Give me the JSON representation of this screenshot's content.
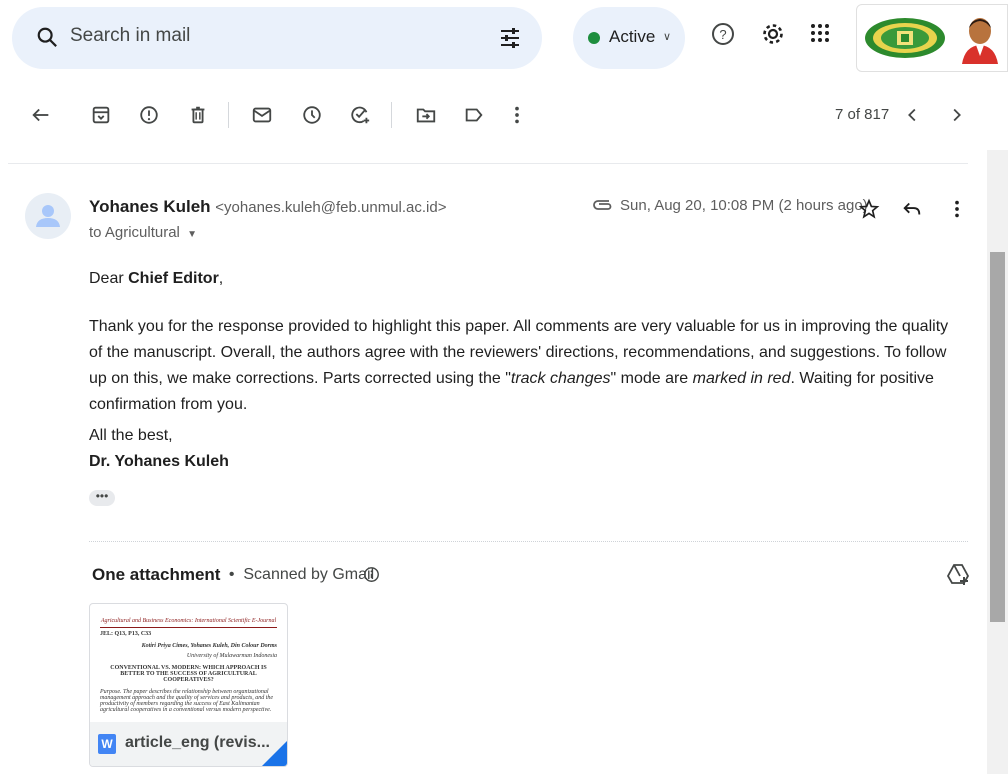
{
  "search": {
    "placeholder": "Search in mail"
  },
  "status": {
    "label": "Active"
  },
  "toolbar": {
    "pager": "7 of 817"
  },
  "message": {
    "sender_name": "Yohanes Kuleh",
    "sender_email": "<yohanes.kuleh@feb.unmul.ac.id>",
    "to_line": "to Agricultural",
    "date": "Sun, Aug 20, 10:08 PM (2 hours ago)",
    "greeting_prefix": "Dear ",
    "greeting_name": "Chief Editor",
    "greeting_suffix": ",",
    "para_1": "Thank you for the response provided to highlight this paper. All comments are very valuable for us in improving the quality of the manuscript. Overall, the authors agree with the reviewers' directions, recommendations, and suggestions. To follow up on this, we make corrections. Parts corrected using the \"",
    "para_track": "track changes",
    "para_2": "\" mode are ",
    "para_marked": "marked in red",
    "para_3": ". Waiting for positive confirmation from you.",
    "closing": "All the best,",
    "signature": "Dr. Yohanes Kuleh",
    "ellipsis": "•••"
  },
  "attachments": {
    "title": "One attachment",
    "scan_text": "  •  Scanned by Gmail",
    "file_name": "article_eng (revis...",
    "preview": {
      "journal": "Agricultural and Business Economics: International Scientific E-Journal",
      "ref": "JEL: Q13, P13, C33",
      "authors": "Kotiri Priya Cimes, Yohanes Kuleh, Din Colour Dorms",
      "affil": "University of Mulawarman Indonesia",
      "title": "CONVENTIONAL VS. MODERN: WHICH APPROACH IS BETTER TO THE SUCCESS OF AGRICULTURAL COOPERATIVES?",
      "abstract": "Purpose. The paper describes the relationship between organizational management approach and the quality of services and products, and the productivity of members regarding the success of East Kalimantan agricultural cooperatives in a conventional versus modern perspective."
    }
  },
  "colors": {
    "accent": "#1a73e8",
    "status_green": "#1e8e3e",
    "search_bg": "#eaf1fb"
  }
}
